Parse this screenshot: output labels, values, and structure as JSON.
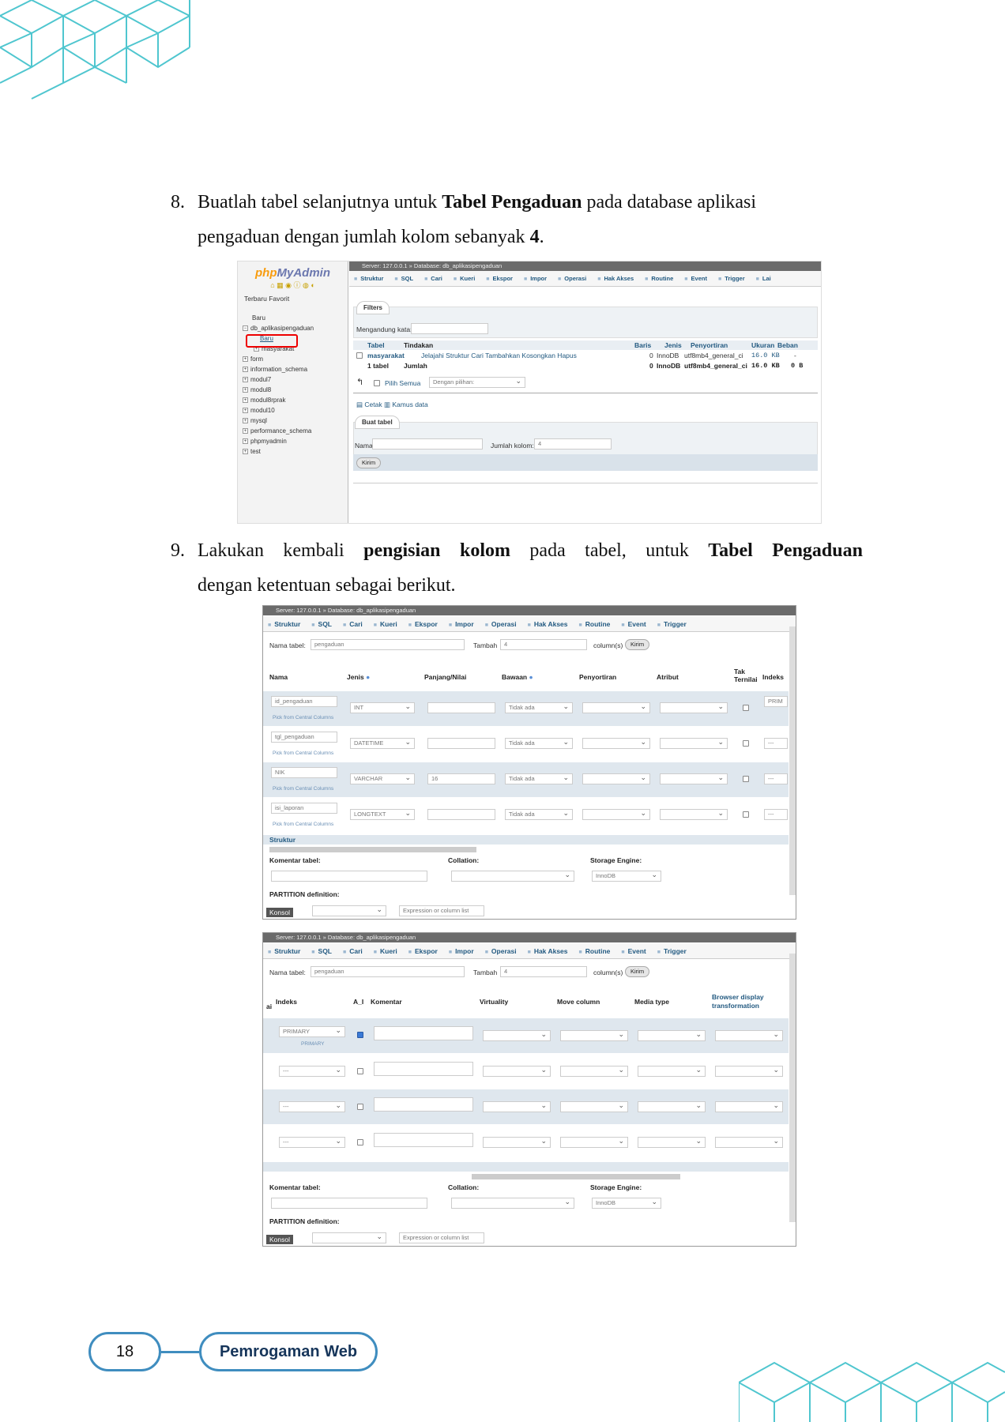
{
  "steps": [
    {
      "number": "8.",
      "pre": "Buatlah tabel selanjutnya untuk ",
      "bold": "Tabel Pengaduan",
      "post": " pada database aplikasi",
      "line2_pre": "pengaduan dengan jumlah kolom sebanyak ",
      "line2_bold": "4",
      "line2_post": "."
    },
    {
      "number": "9.",
      "pre": "Lakukan kembali ",
      "bold": "pengisian kolom",
      "mid": " pada tabel, untuk ",
      "bold2": "Tabel Pengaduan",
      "line2": "dengan ketentuan sebagai berikut."
    }
  ],
  "shot1": {
    "logo_a": "php",
    "logo_b": "MyAdmin",
    "recent": "Terbaru",
    "fav": "Favorit",
    "tree": [
      "Baru",
      "db_aplikasipengaduan",
      "Baru",
      "masyarakat",
      "form",
      "information_schema",
      "modul7",
      "modul8",
      "modul8rprak",
      "modul10",
      "mysql",
      "performance_schema",
      "phpmyadmin",
      "test"
    ],
    "breadcrumb": "Server: 127.0.0.1 » Database: db_aplikasipengaduan",
    "tabs": [
      "Struktur",
      "SQL",
      "Cari",
      "Kueri",
      "Ekspor",
      "Impor",
      "Operasi",
      "Hak Akses",
      "Routine",
      "Event",
      "Trigger",
      "Lai"
    ],
    "filters": "Filters",
    "contains": "Mengandung kata:",
    "headers": [
      "Tabel",
      "Tindakan",
      "Baris",
      "Jenis",
      "Penyortiran",
      "Ukuran",
      "Beban"
    ],
    "row": {
      "name": "masyarakat",
      "actions": "Jelajahi   Struktur   Cari   Tambahkan   Kosongkan   Hapus",
      "rows": "0",
      "type": "InnoDB",
      "collation": "utf8mb4_general_ci",
      "size": "16.0 KB",
      "overhead": "-"
    },
    "total": {
      "label": "1 tabel",
      "sum": "Jumlah",
      "rows": "0",
      "type": "InnoDB",
      "collation": "utf8mb4_general_ci",
      "size": "16.0 KB",
      "overhead": "0 B"
    },
    "select_all": "Pilih Semua",
    "with_selected": "Dengan pilihan:",
    "print": "Cetak",
    "dictionary": "Kamus data",
    "create": "Buat tabel",
    "name_label": "Nama:",
    "cols_label": "Jumlah kolom:",
    "cols_value": "4",
    "submit": "Kirim"
  },
  "shot2": {
    "breadcrumb": "Server: 127.0.0.1 » Database: db_aplikasipengaduan",
    "tabs": [
      "Struktur",
      "SQL",
      "Cari",
      "Kueri",
      "Ekspor",
      "Impor",
      "Operasi",
      "Hak Akses",
      "Routine",
      "Event",
      "Trigger"
    ],
    "table_label": "Nama tabel:",
    "table_value": "pengaduan",
    "add_label": "Tambah",
    "add_value": "4",
    "cols_suffix": "column(s)",
    "go": "Kirim",
    "headers": [
      "Nama",
      "Jenis",
      "Panjang/Nilai",
      "Bawaan",
      "Penyortiran",
      "Atribut",
      "Tak Ternilai",
      "Indeks"
    ],
    "rows": [
      {
        "name": "id_pengaduan",
        "type": "INT",
        "len": "",
        "def": "Tidak ada",
        "idx": "PRIM"
      },
      {
        "name": "tgl_pengaduan",
        "type": "DATETIME",
        "len": "",
        "def": "Tidak ada",
        "idx": "---"
      },
      {
        "name": "NIK",
        "type": "VARCHAR",
        "len": "16",
        "def": "Tidak ada",
        "idx": "---"
      },
      {
        "name": "isi_laporan",
        "type": "LONGTEXT",
        "len": "",
        "def": "Tidak ada",
        "idx": "---"
      }
    ],
    "central": "Pick from Central Columns",
    "structure": "Struktur",
    "comment": "Komentar tabel:",
    "collation": "Collation:",
    "engine": "Storage Engine:",
    "engine_value": "InnoDB",
    "partition": "PARTITION definition:",
    "console": "Konsol",
    "expr": "Expression or column list"
  },
  "shot3": {
    "breadcrumb": "Server: 127.0.0.1 » Database: db_aplikasipengaduan",
    "tabs": [
      "Struktur",
      "SQL",
      "Cari",
      "Kueri",
      "Ekspor",
      "Impor",
      "Operasi",
      "Hak Akses",
      "Routine",
      "Event",
      "Trigger"
    ],
    "table_label": "Nama tabel:",
    "table_value": "pengaduan",
    "add_label": "Tambah",
    "add_value": "4",
    "cols_suffix": "column(s)",
    "go": "Kirim",
    "headers": [
      "ai",
      "Indeks",
      "A_I",
      "Komentar",
      "Virtuality",
      "Move column",
      "Media type",
      "Browser display transformation"
    ],
    "rows": [
      {
        "idx": "PRIMARY",
        "sub": "PRIMARY",
        "ai": true
      },
      {
        "idx": "---",
        "sub": "",
        "ai": false
      },
      {
        "idx": "---",
        "sub": "",
        "ai": false
      },
      {
        "idx": "---",
        "sub": "",
        "ai": false
      }
    ],
    "comment": "Komentar tabel:",
    "collation": "Collation:",
    "engine": "Storage Engine:",
    "engine_value": "InnoDB",
    "partition": "PARTITION definition:",
    "console": "Konsol",
    "expr": "Expression or column list"
  },
  "footer": {
    "page": "18",
    "title": "Pemrogaman Web"
  },
  "colors": {
    "accent": "#3f8dbf",
    "deco": "#4fc6cf",
    "title": "#16355a"
  }
}
